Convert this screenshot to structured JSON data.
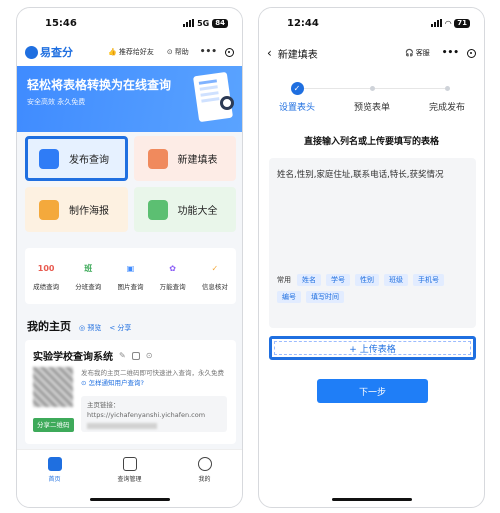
{
  "left": {
    "status": {
      "time": "15:46",
      "network": "5G",
      "battery": "84"
    },
    "appbar": {
      "logo": "易查分",
      "recommend": "推荐给好友",
      "help": "帮助"
    },
    "banner": {
      "title": "轻松将表格转换为在线查询",
      "subtitle": "安全高效 永久免费"
    },
    "tiles": [
      "发布查询",
      "新建填表",
      "制作海报",
      "功能大全"
    ],
    "quick": [
      {
        "label": "成绩查询",
        "glyph": "100",
        "color": "#e85a4f"
      },
      {
        "label": "分班查询",
        "glyph": "班",
        "color": "#3eaa5a"
      },
      {
        "label": "图片查询",
        "glyph": "▣",
        "color": "#3f8bff"
      },
      {
        "label": "万能查询",
        "glyph": "✿",
        "color": "#8a5cf6"
      },
      {
        "label": "信息核对",
        "glyph": "✓",
        "color": "#f4a93c"
      }
    ],
    "myhome": {
      "title": "我的主页",
      "preview": "◎ 预览",
      "share": "< 分享"
    },
    "card": {
      "title": "实验学校查询系统",
      "desc": "发布我的主页二维码即可快速进入查询，永久免费",
      "desc_link": "⊙ 怎样通知用户查询?",
      "link_label": "主页链接：",
      "link_url": "https://yichafenyanshi.yichafen.com",
      "share_btn": "分享二维码"
    },
    "tabs": [
      "首页",
      "查询管理",
      "我的"
    ]
  },
  "right": {
    "status": {
      "time": "12:44",
      "battery": "71"
    },
    "nav": {
      "title": "新建填表",
      "service": "客服"
    },
    "steps": [
      "设置表头",
      "预览表单",
      "完成发布"
    ],
    "instruction": "直接输入列名或上传要填写的表格",
    "input_text": "姓名,性别,家庭住址,联系电话,特长,获奖情况",
    "common_label": "常用",
    "chips": [
      "姓名",
      "学号",
      "性别",
      "班级",
      "手机号",
      "编号",
      "填写时间"
    ],
    "upload_label": "+ 上传表格",
    "next_label": "下一步"
  }
}
